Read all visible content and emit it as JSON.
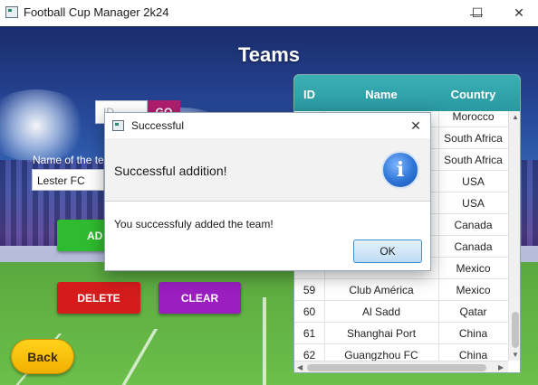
{
  "window": {
    "title": "Football Cup Manager 2k24",
    "minimize_glyph": "—",
    "maximize_glyph": "☐",
    "close_glyph": "✕"
  },
  "page": {
    "title": "Teams"
  },
  "form": {
    "id_placeholder": "ID",
    "go_label": "GO",
    "name_label": "Name of the te",
    "name_value": "Lester FC",
    "add_label": "AD",
    "delete_label": "DELETE",
    "clear_label": "CLEAR",
    "back_label": "Back"
  },
  "table": {
    "headers": {
      "id": "ID",
      "name": "Name",
      "country": "Country"
    },
    "rows": [
      {
        "id": "",
        "name": "",
        "country": "Morocco"
      },
      {
        "id": "",
        "name": "",
        "country": "South Africa"
      },
      {
        "id": "",
        "name": "",
        "country": "South Africa"
      },
      {
        "id": "",
        "name": "",
        "country": "USA"
      },
      {
        "id": "",
        "name": "",
        "country": "USA"
      },
      {
        "id": "",
        "name": "",
        "country": "Canada"
      },
      {
        "id": "",
        "name": "",
        "country": "Canada"
      },
      {
        "id": "",
        "name": "",
        "country": "Mexico"
      },
      {
        "id": "59",
        "name": "Club América",
        "country": "Mexico"
      },
      {
        "id": "60",
        "name": "Al Sadd",
        "country": "Qatar"
      },
      {
        "id": "61",
        "name": "Shanghai Port",
        "country": "China"
      },
      {
        "id": "62",
        "name": "Guangzhou FC",
        "country": "China"
      }
    ]
  },
  "dialog": {
    "title": "Successful",
    "header": "Successful addition!",
    "content": "You successfuly added the team!",
    "ok_label": "OK",
    "close_glyph": "✕",
    "info_glyph": "i"
  },
  "colors": {
    "go": "#b01e6e",
    "add": "#2fbb2f",
    "delete": "#d41c1c",
    "clear": "#9a1ec0",
    "back": "#ffc90e",
    "table_header": "#2fa3aa"
  }
}
